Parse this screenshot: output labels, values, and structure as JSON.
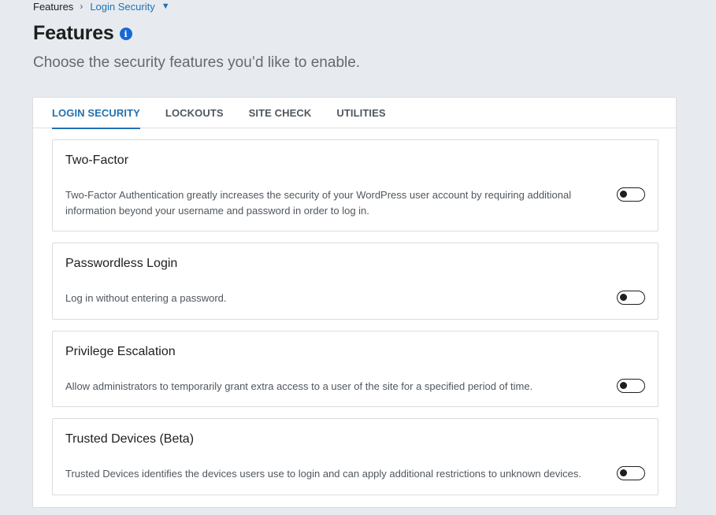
{
  "breadcrumb": {
    "root": "Features",
    "separator": "›",
    "current": "Login Security",
    "caret": "▼"
  },
  "header": {
    "title": "Features",
    "info_icon": "i",
    "subtitle": "Choose the security features you’d like to enable."
  },
  "tabs": [
    {
      "label": "LOGIN SECURITY",
      "active": true
    },
    {
      "label": "LOCKOUTS",
      "active": false
    },
    {
      "label": "SITE CHECK",
      "active": false
    },
    {
      "label": "UTILITIES",
      "active": false
    }
  ],
  "features": [
    {
      "title": "Two-Factor",
      "description": "Two-Factor Authentication greatly increases the security of your WordPress user account by requiring additional information beyond your username and password in order to log in.",
      "enabled": false
    },
    {
      "title": "Passwordless Login",
      "description": "Log in without entering a password.",
      "enabled": false
    },
    {
      "title": "Privilege Escalation",
      "description": "Allow administrators to temporarily grant extra access to a user of the site for a specified period of time.",
      "enabled": false
    },
    {
      "title": "Trusted Devices (Beta)",
      "description": "Trusted Devices identifies the devices users use to login and can apply additional restrictions to unknown devices.",
      "enabled": false
    }
  ],
  "colors": {
    "accent": "#2271b1",
    "info_icon": "#1768d5",
    "background": "#e7ebef"
  }
}
